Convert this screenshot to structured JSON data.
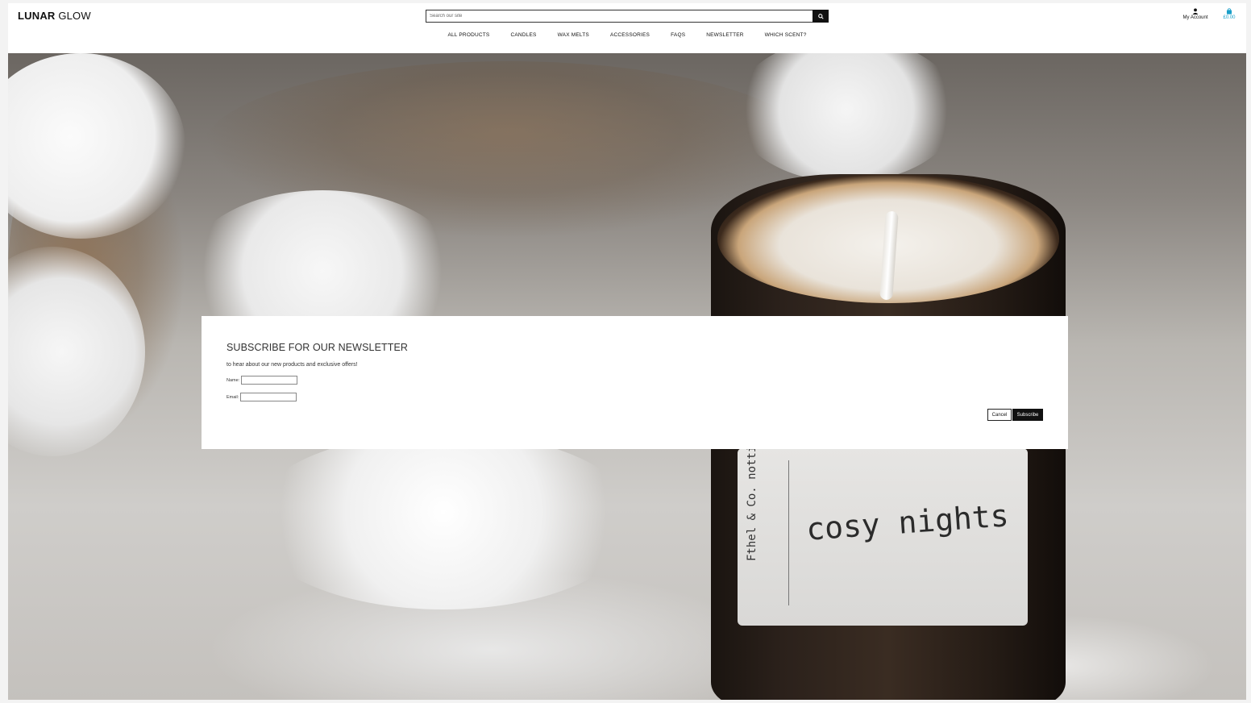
{
  "brand": {
    "logo_bold": "LUNAR",
    "logo_light": "GLOW"
  },
  "search": {
    "placeholder": "Search our site",
    "button_icon": "search-icon"
  },
  "account": {
    "label": "My Account",
    "icon": "user-icon"
  },
  "cart": {
    "total": "£0.00",
    "icon": "shopping-bag-icon",
    "color": "#1a9fc9"
  },
  "nav": {
    "items": [
      {
        "label": "ALL PRODUCTS"
      },
      {
        "label": "CANDLES"
      },
      {
        "label": "WAX MELTS"
      },
      {
        "label": "ACCESSORIES"
      },
      {
        "label": "FAQS"
      },
      {
        "label": "NEWSLETTER"
      },
      {
        "label": "WHICH SCENT?"
      }
    ]
  },
  "hero": {
    "label_brand": "Fthel & Co. nottingham",
    "label_text": "cosy nights"
  },
  "newsletter_modal": {
    "title": "SUBSCRIBE FOR OUR NEWSLETTER",
    "subtitle": "to hear about our new products and exclusive offers!",
    "name_label": "Name:",
    "name_value": "",
    "email_label": "Email:",
    "email_value": "",
    "cancel_label": "Cancel",
    "subscribe_label": "Subscribe"
  }
}
